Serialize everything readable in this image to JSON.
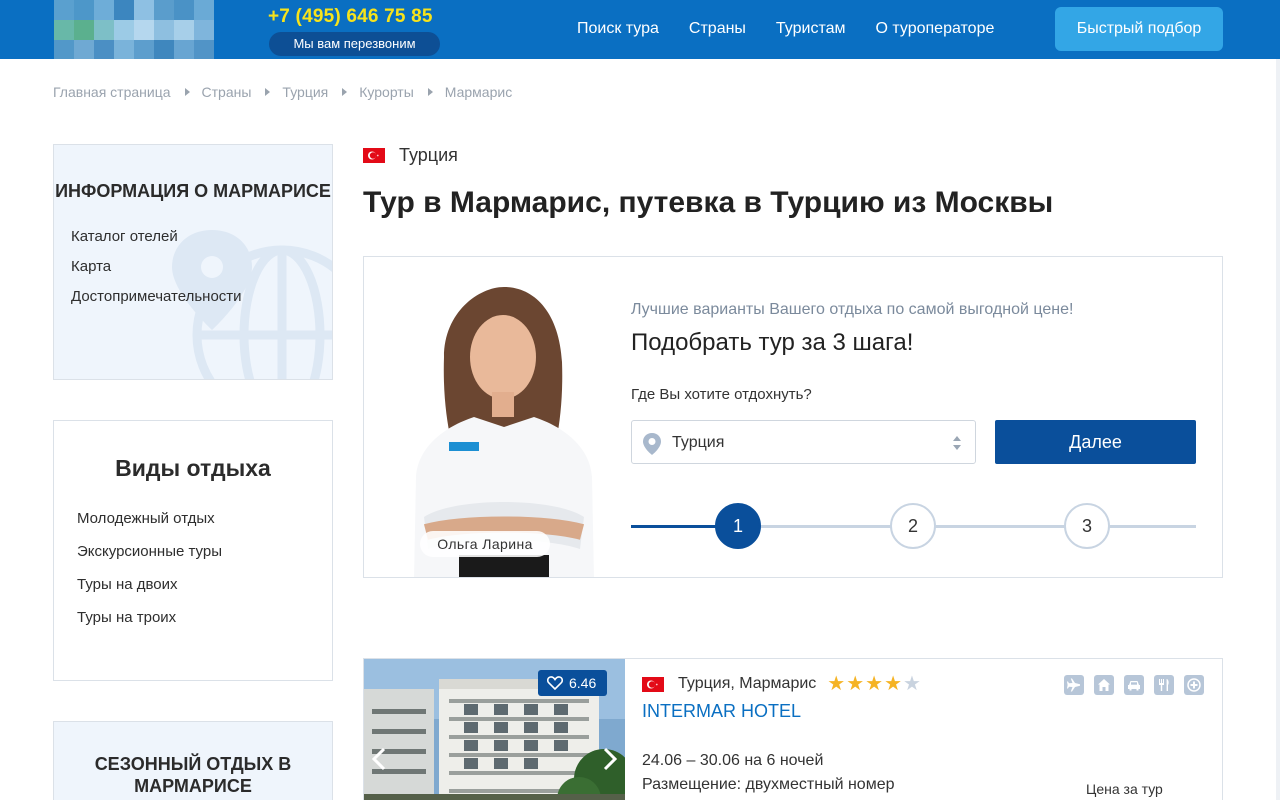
{
  "header": {
    "phone": "+7 (495) 646 75 85",
    "callback_label": "Мы вам перезвоним",
    "nav": [
      "Поиск тура",
      "Страны",
      "Туристам",
      "О туроператоре"
    ],
    "quick_button": "Быстрый подбор",
    "colors": {
      "bar": "#0a6fc2",
      "phone": "#f7e31b",
      "button": "#33a6e6"
    }
  },
  "breadcrumb": [
    "Главная страница",
    "Страны",
    "Турция",
    "Курорты",
    "Мармарис"
  ],
  "sidebar": {
    "info": {
      "title": "ИНФОРМАЦИЯ О МАРМАРИСЕ",
      "links": [
        "Каталог отелей",
        "Карта",
        "Достопримечательности"
      ]
    },
    "types": {
      "title": "Виды отдыха",
      "links": [
        "Молодежный отдых",
        "Экскурсионные туры",
        "Туры на двоих",
        "Туры на троих"
      ]
    },
    "season": {
      "title": "СЕЗОННЫЙ ОТДЫХ В МАРМАРИСЕ"
    }
  },
  "main": {
    "country": "Турция",
    "title": "Тур в Мармарис, путевка в Турцию из Москвы"
  },
  "picker": {
    "subtitle": "Лучшие варианты Вашего отдыха по самой выгодной цене!",
    "title": "Подобрать тур за 3 шага!",
    "question": "Где Вы хотите отдохнуть?",
    "select_value": "Турция",
    "next_button": "Далее",
    "agent_name": "Ольга Ларина",
    "steps": [
      "1",
      "2",
      "3"
    ],
    "current_step": 1
  },
  "hotel": {
    "rating": "6.46",
    "location": "Турция, Мармарис",
    "stars": 4,
    "max_stars": 5,
    "name": "INTERMAR HOTEL",
    "dates": "24.06 – 30.06 на 6 ночей",
    "room": "Размещение: двухместный номер",
    "price_label": "Цена за тур",
    "amenity_icons": [
      "plane-icon",
      "house-icon",
      "car-icon",
      "restaurant-icon",
      "medical-icon"
    ]
  }
}
